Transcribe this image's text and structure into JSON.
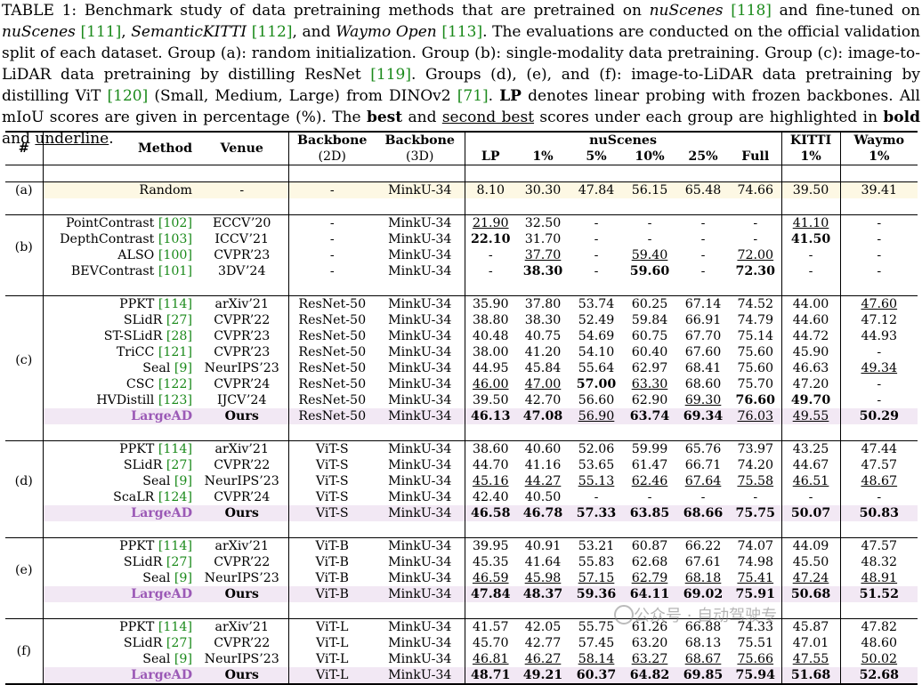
{
  "caption": {
    "table_no": "TABLE 1:",
    "t1": " Benchmark study of data pretraining methods that are pretrained on ",
    "nuscenes": "nuScenes",
    "c118": "[118]",
    "t2": " and fine-tuned on ",
    "nuscenes2": "nuScenes",
    "c111": "[111]",
    "t3": ", ",
    "skitti": "SemanticKITTI",
    "c112": "[112]",
    "t4": ", and ",
    "waymo": "Waymo Open",
    "c113": "[113]",
    "t5": ". The evaluations are conducted on the official validation split of each dataset. Group (a): random initialization. Group (b): single-modality data pretraining. Group (c): image-to-LiDAR data pretraining by distilling ResNet ",
    "c119": "[119]",
    "t6": ". Groups (d), (e), and (f): image-to-LiDAR data pretraining by distilling ViT ",
    "c120": "[120]",
    "t7": " (Small, Medium, Large) from DINOv2 ",
    "c71": "[71]",
    "t8": ". ",
    "lp": "LP",
    "t9": " denotes linear probing with frozen backbones. All mIoU scores are given in percentage (%). The ",
    "best": "best",
    "t10": " and ",
    "second": "second best",
    "t11": " scores under each group are highlighted in ",
    "bold": "bold",
    "t12": " and ",
    "underline": "underline",
    "t13": "."
  },
  "header": {
    "hash": "#",
    "method": "Method",
    "venue": "Venue",
    "bb2d": "Backbone",
    "bb2d_sub": "(2D)",
    "bb3d": "Backbone",
    "bb3d_sub": "(3D)",
    "nuscenes": "nuScenes",
    "kitti": "KITTI",
    "waymo": "Waymo",
    "cols": [
      "LP",
      "1%",
      "5%",
      "10%",
      "25%",
      "Full"
    ],
    "kitti_sub": "1%",
    "waymo_sub": "1%"
  },
  "groups": [
    {
      "label": "(a)",
      "rows": [
        {
          "m": "Random",
          "cite": "",
          "v": "-",
          "b2": "-",
          "b3": "MinkU-34",
          "vals": [
            "8.10",
            "30.30",
            "47.84",
            "56.15",
            "65.48",
            "74.66",
            "39.50",
            "39.41"
          ],
          "bold": [],
          "und": [],
          "hl": "rand"
        }
      ]
    },
    {
      "label": "(b)",
      "rows": [
        {
          "m": "PointContrast",
          "cite": "[102]",
          "v": "ECCV’20",
          "b2": "-",
          "b3": "MinkU-34",
          "vals": [
            "21.90",
            "32.50",
            "-",
            "-",
            "-",
            "-",
            "41.10",
            "-"
          ],
          "bold": [],
          "und": [
            0,
            6
          ]
        },
        {
          "m": "DepthContrast",
          "cite": "[103]",
          "v": "ICCV’21",
          "b2": "-",
          "b3": "MinkU-34",
          "vals": [
            "22.10",
            "31.70",
            "-",
            "-",
            "-",
            "-",
            "41.50",
            "-"
          ],
          "bold": [
            0,
            6
          ],
          "und": []
        },
        {
          "m": "ALSO",
          "cite": "[100]",
          "v": "CVPR’23",
          "b2": "-",
          "b3": "MinkU-34",
          "vals": [
            "-",
            "37.70",
            "-",
            "59.40",
            "-",
            "72.00",
            "-",
            "-"
          ],
          "bold": [],
          "und": [
            1,
            3,
            5
          ]
        },
        {
          "m": "BEVContrast",
          "cite": "[101]",
          "v": "3DV’24",
          "b2": "-",
          "b3": "MinkU-34",
          "vals": [
            "-",
            "38.30",
            "-",
            "59.60",
            "-",
            "72.30",
            "-",
            "-"
          ],
          "bold": [
            1,
            3,
            5
          ],
          "und": []
        }
      ]
    },
    {
      "label": "(c)",
      "rows": [
        {
          "m": "PPKT",
          "cite": "[114]",
          "v": "arXiv’21",
          "b2": "ResNet-50",
          "b3": "MinkU-34",
          "vals": [
            "35.90",
            "37.80",
            "53.74",
            "60.25",
            "67.14",
            "74.52",
            "44.00",
            "47.60"
          ],
          "bold": [],
          "und": [
            7
          ]
        },
        {
          "m": "SLidR",
          "cite": "[27]",
          "v": "CVPR’22",
          "b2": "ResNet-50",
          "b3": "MinkU-34",
          "vals": [
            "38.80",
            "38.30",
            "52.49",
            "59.84",
            "66.91",
            "74.79",
            "44.60",
            "47.12"
          ],
          "bold": [],
          "und": []
        },
        {
          "m": "ST-SLidR",
          "cite": "[28]",
          "v": "CVPR’23",
          "b2": "ResNet-50",
          "b3": "MinkU-34",
          "vals": [
            "40.48",
            "40.75",
            "54.69",
            "60.75",
            "67.70",
            "75.14",
            "44.72",
            "44.93"
          ],
          "bold": [],
          "und": []
        },
        {
          "m": "TriCC",
          "cite": "[121]",
          "v": "CVPR’23",
          "b2": "ResNet-50",
          "b3": "MinkU-34",
          "vals": [
            "38.00",
            "41.20",
            "54.10",
            "60.40",
            "67.60",
            "75.60",
            "45.90",
            "-"
          ],
          "bold": [],
          "und": []
        },
        {
          "m": "Seal",
          "cite": "[9]",
          "v": "NeurIPS’23",
          "b2": "ResNet-50",
          "b3": "MinkU-34",
          "vals": [
            "44.95",
            "45.84",
            "55.64",
            "62.97",
            "68.41",
            "75.60",
            "46.63",
            "49.34"
          ],
          "bold": [],
          "und": [
            7
          ]
        },
        {
          "m": "CSC",
          "cite": "[122]",
          "v": "CVPR’24",
          "b2": "ResNet-50",
          "b3": "MinkU-34",
          "vals": [
            "46.00",
            "47.00",
            "57.00",
            "63.30",
            "68.60",
            "75.70",
            "47.20",
            "-"
          ],
          "bold": [
            2
          ],
          "und": [
            0,
            1,
            3
          ]
        },
        {
          "m": "HVDistill",
          "cite": "[123]",
          "v": "IJCV’24",
          "b2": "ResNet-50",
          "b3": "MinkU-34",
          "vals": [
            "39.50",
            "42.70",
            "56.60",
            "62.90",
            "69.30",
            "76.60",
            "49.70",
            "-"
          ],
          "bold": [
            5,
            6
          ],
          "und": [
            4
          ]
        },
        {
          "m": "LargeAD",
          "cite": "",
          "v": "Ours",
          "b2": "ResNet-50",
          "b3": "MinkU-34",
          "vals": [
            "46.13",
            "47.08",
            "56.90",
            "63.74",
            "69.34",
            "76.03",
            "49.55",
            "50.29"
          ],
          "bold": [
            0,
            1,
            3,
            4,
            7
          ],
          "und": [
            2,
            5,
            6
          ],
          "hl": "ours"
        }
      ]
    },
    {
      "label": "(d)",
      "rows": [
        {
          "m": "PPKT",
          "cite": "[114]",
          "v": "arXiv’21",
          "b2": "ViT-S",
          "b3": "MinkU-34",
          "vals": [
            "38.60",
            "40.60",
            "52.06",
            "59.99",
            "65.76",
            "73.97",
            "43.25",
            "47.44"
          ],
          "bold": [],
          "und": []
        },
        {
          "m": "SLidR",
          "cite": "[27]",
          "v": "CVPR’22",
          "b2": "ViT-S",
          "b3": "MinkU-34",
          "vals": [
            "44.70",
            "41.16",
            "53.65",
            "61.47",
            "66.71",
            "74.20",
            "44.67",
            "47.57"
          ],
          "bold": [],
          "und": []
        },
        {
          "m": "Seal",
          "cite": "[9]",
          "v": "NeurIPS’23",
          "b2": "ViT-S",
          "b3": "MinkU-34",
          "vals": [
            "45.16",
            "44.27",
            "55.13",
            "62.46",
            "67.64",
            "75.58",
            "46.51",
            "48.67"
          ],
          "bold": [],
          "und": [
            0,
            1,
            2,
            3,
            4,
            5,
            6,
            7
          ]
        },
        {
          "m": "ScaLR",
          "cite": "[124]",
          "v": "CVPR’24",
          "b2": "ViT-S",
          "b3": "MinkU-34",
          "vals": [
            "42.40",
            "40.50",
            "-",
            "-",
            "-",
            "-",
            "-",
            "-"
          ],
          "bold": [],
          "und": []
        },
        {
          "m": "LargeAD",
          "cite": "",
          "v": "Ours",
          "b2": "ViT-S",
          "b3": "MinkU-34",
          "vals": [
            "46.58",
            "46.78",
            "57.33",
            "63.85",
            "68.66",
            "75.75",
            "50.07",
            "50.83"
          ],
          "bold": [
            0,
            1,
            2,
            3,
            4,
            5,
            6,
            7
          ],
          "und": [],
          "hl": "ours"
        }
      ]
    },
    {
      "label": "(e)",
      "rows": [
        {
          "m": "PPKT",
          "cite": "[114]",
          "v": "arXiv’21",
          "b2": "ViT-B",
          "b3": "MinkU-34",
          "vals": [
            "39.95",
            "40.91",
            "53.21",
            "60.87",
            "66.22",
            "74.07",
            "44.09",
            "47.57"
          ],
          "bold": [],
          "und": []
        },
        {
          "m": "SLidR",
          "cite": "[27]",
          "v": "CVPR’22",
          "b2": "ViT-B",
          "b3": "MinkU-34",
          "vals": [
            "45.35",
            "41.64",
            "55.83",
            "62.68",
            "67.61",
            "74.98",
            "45.50",
            "48.32"
          ],
          "bold": [],
          "und": []
        },
        {
          "m": "Seal",
          "cite": "[9]",
          "v": "NeurIPS’23",
          "b2": "ViT-B",
          "b3": "MinkU-34",
          "vals": [
            "46.59",
            "45.98",
            "57.15",
            "62.79",
            "68.18",
            "75.41",
            "47.24",
            "48.91"
          ],
          "bold": [],
          "und": [
            0,
            1,
            2,
            3,
            4,
            5,
            6,
            7
          ]
        },
        {
          "m": "LargeAD",
          "cite": "",
          "v": "Ours",
          "b2": "ViT-B",
          "b3": "MinkU-34",
          "vals": [
            "47.84",
            "48.37",
            "59.36",
            "64.11",
            "69.02",
            "75.91",
            "50.68",
            "51.52"
          ],
          "bold": [
            0,
            1,
            2,
            3,
            4,
            5,
            6,
            7
          ],
          "und": [],
          "hl": "ours"
        }
      ]
    },
    {
      "label": "(f)",
      "rows": [
        {
          "m": "PPKT",
          "cite": "[114]",
          "v": "arXiv’21",
          "b2": "ViT-L",
          "b3": "MinkU-34",
          "vals": [
            "41.57",
            "42.05",
            "55.75",
            "61.26",
            "66.88",
            "74.33",
            "45.87",
            "47.82"
          ],
          "bold": [],
          "und": []
        },
        {
          "m": "SLidR",
          "cite": "[27]",
          "v": "CVPR’22",
          "b2": "ViT-L",
          "b3": "MinkU-34",
          "vals": [
            "45.70",
            "42.77",
            "57.45",
            "63.20",
            "68.13",
            "75.51",
            "47.01",
            "48.60"
          ],
          "bold": [],
          "und": []
        },
        {
          "m": "Seal",
          "cite": "[9]",
          "v": "NeurIPS’23",
          "b2": "ViT-L",
          "b3": "MinkU-34",
          "vals": [
            "46.81",
            "46.27",
            "58.14",
            "63.27",
            "68.67",
            "75.66",
            "47.55",
            "50.02"
          ],
          "bold": [],
          "und": [
            0,
            1,
            2,
            3,
            4,
            5,
            6,
            7
          ]
        },
        {
          "m": "LargeAD",
          "cite": "",
          "v": "Ours",
          "b2": "ViT-L",
          "b3": "MinkU-34",
          "vals": [
            "48.71",
            "49.21",
            "60.37",
            "64.82",
            "69.85",
            "75.94",
            "51.68",
            "52.68"
          ],
          "bold": [
            0,
            1,
            2,
            3,
            4,
            5,
            6,
            7
          ],
          "und": [],
          "hl": "ours"
        }
      ]
    }
  ],
  "watermark": "公众号 · 自动驾驶专"
}
